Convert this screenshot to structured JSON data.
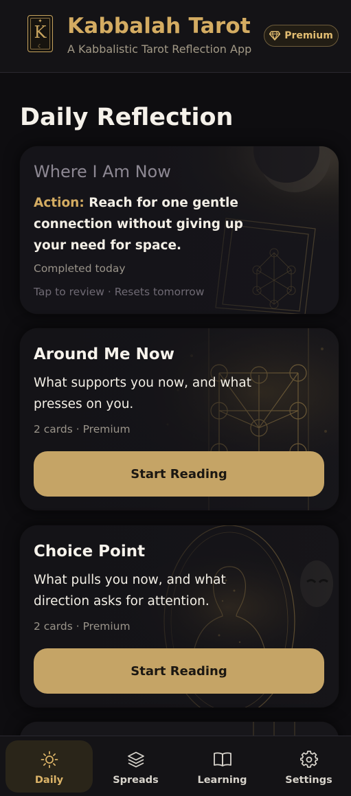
{
  "header": {
    "logo_letter": "K",
    "title": "Kabbalah Tarot",
    "subtitle": "A Kabbalistic Tarot Reflection App",
    "premium_label": "Premium",
    "premium_icon": "diamond-icon"
  },
  "section": {
    "title": "Daily Reflection"
  },
  "cards": [
    {
      "title": "Where I Am Now",
      "action_label": "Action:",
      "action_text": "Reach for one gentle connection without giving up your need for space.",
      "status": "Completed today",
      "hint": "Tap to review · Resets tomorrow"
    },
    {
      "title": "Around Me Now",
      "description": "What supports you now, and what presses on you.",
      "meta": "2 cards · Premium",
      "button": "Start Reading"
    },
    {
      "title": "Choice Point",
      "description": "What pulls you now, and what direction asks for attention.",
      "meta": "2 cards · Premium",
      "button": "Start Reading"
    }
  ],
  "nav": {
    "items": [
      {
        "label": "Daily",
        "icon": "sun-icon",
        "active": true
      },
      {
        "label": "Spreads",
        "icon": "layers-icon",
        "active": false
      },
      {
        "label": "Learning",
        "icon": "book-icon",
        "active": false
      },
      {
        "label": "Settings",
        "icon": "gear-icon",
        "active": false
      }
    ]
  },
  "colors": {
    "accent": "#d4ac62",
    "button": "#c5a466",
    "background": "#0e0d10"
  }
}
